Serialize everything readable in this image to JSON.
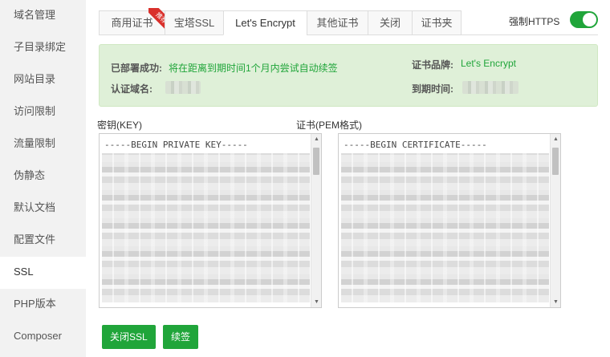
{
  "sidebar": {
    "items": [
      {
        "label": "域名管理"
      },
      {
        "label": "子目录绑定"
      },
      {
        "label": "网站目录"
      },
      {
        "label": "访问限制"
      },
      {
        "label": "流量限制"
      },
      {
        "label": "伪静态"
      },
      {
        "label": "默认文档"
      },
      {
        "label": "配置文件"
      },
      {
        "label": "SSL",
        "active": true
      },
      {
        "label": "PHP版本"
      },
      {
        "label": "Composer"
      }
    ]
  },
  "tabs": [
    {
      "label": "商用证书",
      "badge": "推荐"
    },
    {
      "label": "宝塔SSL"
    },
    {
      "label": "Let's Encrypt",
      "active": true
    },
    {
      "label": "其他证书"
    },
    {
      "label": "关闭"
    },
    {
      "label": "证书夹"
    }
  ],
  "force_https": {
    "label": "强制HTTPS",
    "enabled": true
  },
  "info": {
    "deployed_label": "已部署成功:",
    "deployed_text": "将在距离到期时间1个月内尝试自动续签",
    "brand_label": "证书品牌:",
    "brand_value": "Let's Encrypt",
    "domain_label": "认证域名:",
    "expire_label": "到期时间:"
  },
  "key_area": {
    "label": "密钥(KEY)",
    "first_line": "-----BEGIN PRIVATE KEY-----"
  },
  "cert_area": {
    "label": "证书(PEM格式)",
    "first_line": "-----BEGIN CERTIFICATE-----"
  },
  "buttons": {
    "close_ssl": "关闭SSL",
    "renew": "续签"
  },
  "colors": {
    "accent": "#20a53a",
    "info_bg": "#dff0d8",
    "ribbon": "#d9302b"
  }
}
